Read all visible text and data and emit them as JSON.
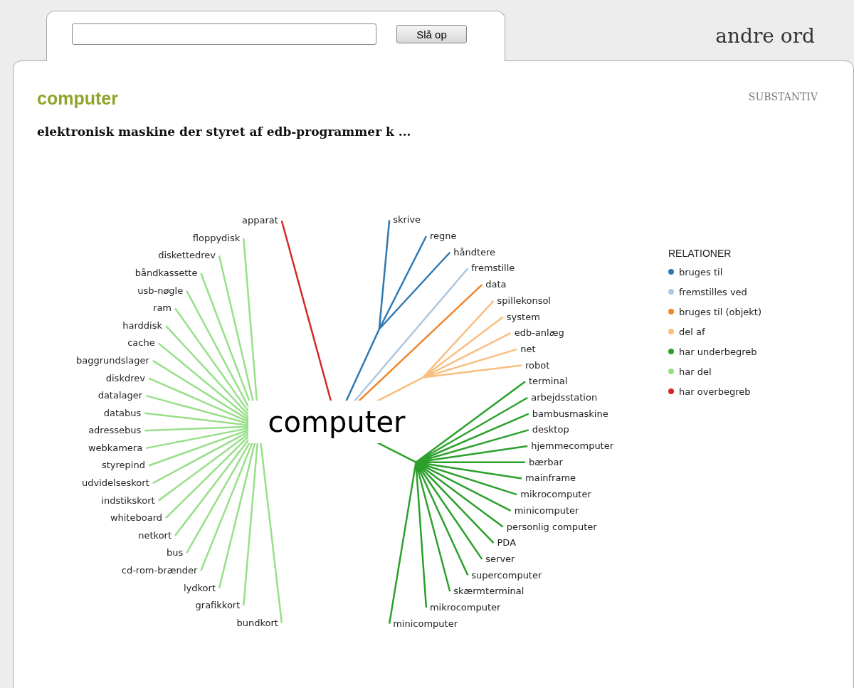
{
  "search": {
    "button": "Slå op"
  },
  "other_link": "andre ord",
  "word": "computer",
  "word_class": "SUBSTANTIV",
  "definition": "elektronisk maskine der styret af edb-programmer k ...",
  "graph": {
    "center": "computer",
    "legend_title": "RELATIONER",
    "relations": [
      {
        "name": "bruges til",
        "color": "#2f78b0",
        "nodes": [
          "skrive",
          "regne",
          "håndtere"
        ]
      },
      {
        "name": "fremstilles ved",
        "color": "#aec7e0",
        "nodes": [
          "fremstille"
        ]
      },
      {
        "name": "bruges til (objekt)",
        "color": "#f0862a",
        "nodes": [
          "data"
        ]
      },
      {
        "name": "del af",
        "color": "#f8bf80",
        "nodes": [
          "spillekonsol",
          "system",
          "edb-anlæg",
          "net",
          "robot"
        ]
      },
      {
        "name": "har underbegreb",
        "color": "#2ca02c",
        "nodes": [
          "terminal",
          "arbejdsstation",
          "bambusmaskine",
          "desktop",
          "hjemmecomputer",
          "bærbar",
          "mainframe",
          "mikrocomputer",
          "minicomputer",
          "personlig computer",
          "PDA",
          "server",
          "supercomputer",
          "skærmterminal",
          "mikrocomputer",
          "minicomputer"
        ]
      },
      {
        "name": "har del",
        "color": "#98df8a",
        "nodes": [
          "floppydisk",
          "diskettedrev",
          "båndkassette",
          "usb-nøgle",
          "ram",
          "harddisk",
          "cache",
          "baggrundslager",
          "diskdrev",
          "datalager",
          "databus",
          "adressebus",
          "webkamera",
          "styrepind",
          "udvidelseskort",
          "indstikskort",
          "whiteboard",
          "netkort",
          "bus",
          "cd-rom-brænder",
          "lydkort",
          "grafikkort",
          "bundkort"
        ]
      },
      {
        "name": "har overbegreb",
        "color": "#d62728",
        "nodes": [
          "apparat"
        ]
      }
    ]
  }
}
